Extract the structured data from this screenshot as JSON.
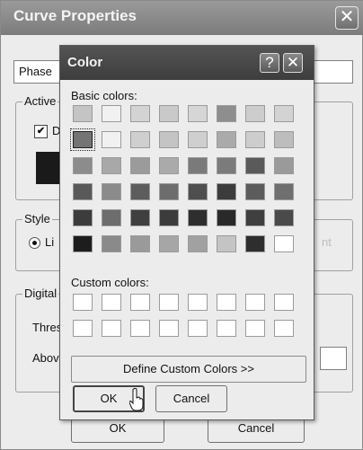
{
  "curve_dialog": {
    "title": "Curve Properties",
    "close_glyph": "✕",
    "phase_label": "Phase",
    "active_group": {
      "label": "Active",
      "checkbox_label": "D",
      "checkbox_checked": true,
      "swatch_color": "#1a1a1a"
    },
    "style_group": {
      "label": "Style",
      "radio_label": "Li",
      "faded_text": "nt"
    },
    "digital_group": {
      "label": "Digital",
      "threshold_label": "Thres",
      "above_label": "Abov"
    },
    "ok_label": "OK",
    "cancel_label": "Cancel"
  },
  "color_dialog": {
    "title": "Color",
    "help_glyph": "?",
    "close_glyph": "✕",
    "basic_colors_label": "Basic colors:",
    "basic_colors": [
      [
        "#c4c4c4",
        "#f1f1f1",
        "#d3d3d3",
        "#c9c9c9",
        "#d6d6d6",
        "#8e8e8e",
        "#cdcdcd",
        "#d3d3d3"
      ],
      [
        "#747474",
        "#f1f1f1",
        "#cfcfcf",
        "#c4c4c4",
        "#cfcfcf",
        "#aaaaaa",
        "#cdcdcd",
        "#bdbdbd"
      ],
      [
        "#8c8c8c",
        "#a8a8a8",
        "#9b9b9b",
        "#aaaaaa",
        "#7a7a7a",
        "#7b7b7b",
        "#5a5a5a",
        "#9a9a9a"
      ],
      [
        "#595959",
        "#8b8b8b",
        "#5d5d5d",
        "#6d6d6d",
        "#4e4e4e",
        "#3c3c3c",
        "#5c5c5c",
        "#6f6f6f"
      ],
      [
        "#3c3c3c",
        "#6d6d6d",
        "#3f3f3f",
        "#3c3c3c",
        "#2e2e2e",
        "#292929",
        "#3f3f3f",
        "#4a4a4a"
      ],
      [
        "#1d1d1d",
        "#8a8a8a",
        "#9a9a9a",
        "#a6a6a6",
        "#a1a1a1",
        "#c4c4c4",
        "#2e2e2e",
        "#ffffff"
      ]
    ],
    "selected_swatch": [
      1,
      0
    ],
    "custom_colors_label": "Custom colors:",
    "custom_rows": 2,
    "custom_cols": 8,
    "define_custom_label": "Define Custom Colors >>",
    "ok_label": "OK",
    "cancel_label": "Cancel"
  }
}
